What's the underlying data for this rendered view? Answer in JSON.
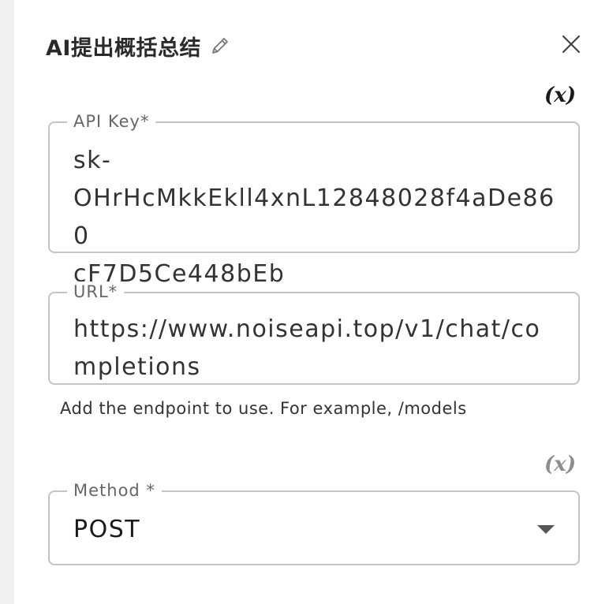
{
  "header": {
    "title": "AI提出概括总结",
    "edit_icon": "pencil-icon",
    "close_icon": "close-icon"
  },
  "api_key": {
    "label": "API Key*",
    "value": "sk-\nOHrHcMkkEkll4xnL12848028f4aDe860\ncF7D5Ce448bEb",
    "variable_button": "(x)"
  },
  "url": {
    "label": "URL*",
    "value": "https://www.noiseapi.top/v1/chat/completions",
    "helper": "Add the endpoint to use. For example, /models"
  },
  "method": {
    "label": "Method *",
    "value": "POST",
    "variable_button": "(x)",
    "dropdown_icon": "chevron-down-icon"
  },
  "colors": {
    "border": "#c4c4c4",
    "label": "#666666",
    "sidebar_strip": "#f1f1f2",
    "variable_inactive": "#8d8d8d"
  }
}
